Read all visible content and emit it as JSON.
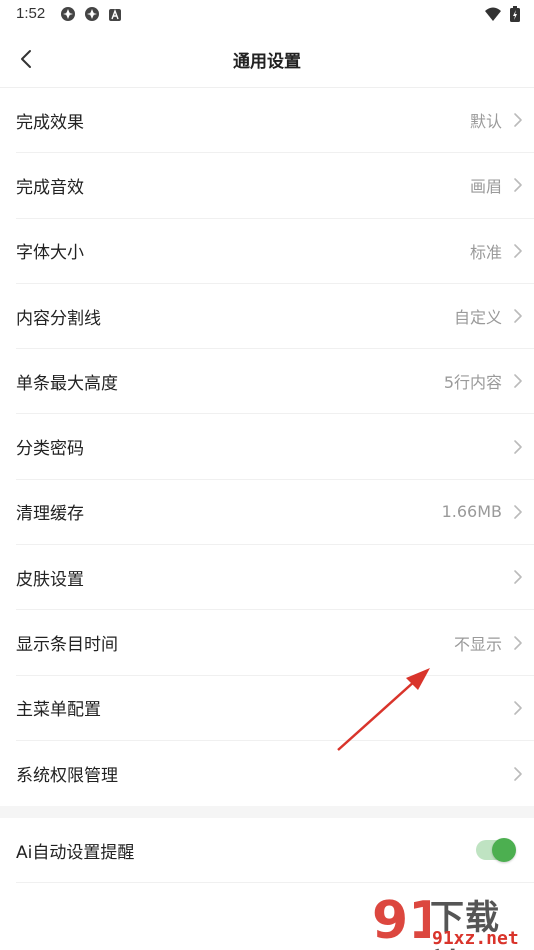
{
  "status_bar": {
    "time": "1:52",
    "left_icons": [
      "app-notification-icon",
      "app-notification-icon",
      "a-badge-icon"
    ],
    "right_icons": [
      "wifi-icon",
      "battery-charging-icon"
    ]
  },
  "header": {
    "title": "通用设置",
    "back_icon": "chevron-left-icon"
  },
  "settings": {
    "items": [
      {
        "label": "完成效果",
        "value": "默认"
      },
      {
        "label": "完成音效",
        "value": "画眉"
      },
      {
        "label": "字体大小",
        "value": "标准"
      },
      {
        "label": "内容分割线",
        "value": "自定义"
      },
      {
        "label": "单条最大高度",
        "value": "5行内容"
      },
      {
        "label": "分类密码",
        "value": ""
      },
      {
        "label": "清理缓存",
        "value": "1.66MB"
      },
      {
        "label": "皮肤设置",
        "value": ""
      },
      {
        "label": "显示条目时间",
        "value": "不显示"
      },
      {
        "label": "主菜单配置",
        "value": ""
      },
      {
        "label": "系统权限管理",
        "value": ""
      }
    ]
  },
  "ai_reminder": {
    "label": "Ai自动设置提醒",
    "enabled": true
  },
  "watermark": {
    "logo_text": "下载站",
    "url_text": "91xz.net"
  },
  "colors": {
    "accent_green": "#4caf50",
    "annotation_red": "#d9342b",
    "secondary_text": "#9a9a9a"
  }
}
